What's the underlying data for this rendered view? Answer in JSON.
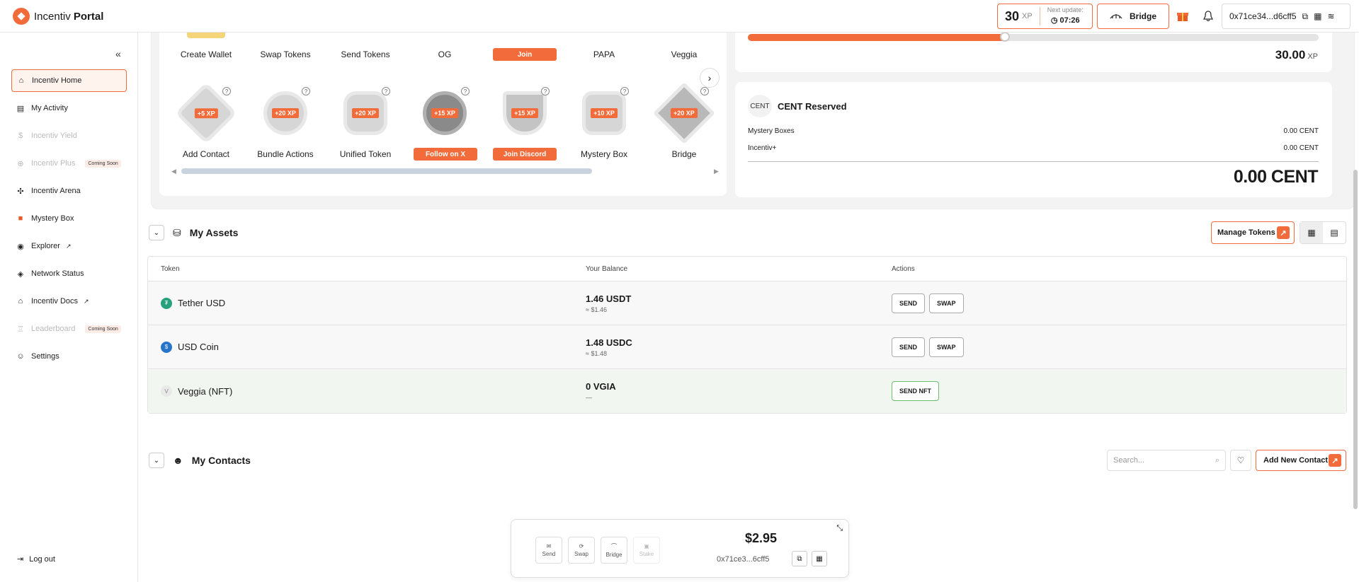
{
  "brand": {
    "name_light": "Incentiv",
    "name_bold": " Portal"
  },
  "topbar": {
    "xp_value": "30",
    "xp_unit": "XP",
    "next_update_label": "Next update:",
    "next_update_time": "07:26",
    "bridge_label": "Bridge",
    "wallet_address": "0x71ce34...d6cff5"
  },
  "sidebar": {
    "items": [
      {
        "label": "Incentiv Home"
      },
      {
        "label": "My Activity"
      },
      {
        "label": "Incentiv Yield"
      },
      {
        "label": "Incentiv Plus",
        "badge": "Coming Soon"
      },
      {
        "label": "Incentiv Arena"
      },
      {
        "label": "Mystery Box"
      },
      {
        "label": "Explorer"
      },
      {
        "label": "Network Status"
      },
      {
        "label": "Incentiv Docs"
      },
      {
        "label": "Leaderboard",
        "badge": "Coming Soon"
      },
      {
        "label": "Settings"
      }
    ],
    "logout": "Log out"
  },
  "quests": {
    "top_labels": [
      "Create Wallet",
      "Swap Tokens",
      "Send Tokens",
      "OG",
      "PAPA",
      "Veggia"
    ],
    "top_pill": "Join",
    "badges": [
      {
        "xp": "+5 XP",
        "label": "Add Contact"
      },
      {
        "xp": "+20 XP",
        "label": "Bundle Actions"
      },
      {
        "xp": "+20 XP",
        "label": "Unified Token"
      },
      {
        "xp": "+15 XP",
        "pill": "Follow on X"
      },
      {
        "xp": "+15 XP",
        "pill": "Join Discord"
      },
      {
        "xp": "+10 XP",
        "label": "Mystery Box"
      },
      {
        "xp": "+20 XP",
        "label": "Bridge"
      }
    ],
    "help_icon": "?"
  },
  "progress": {
    "fraction": 0.45,
    "total_value": "30.00",
    "total_unit": "XP"
  },
  "cent": {
    "img_alt": "CENT",
    "title": "CENT Reserved",
    "rows": [
      {
        "label": "Mystery Boxes",
        "value": "0.00 CENT"
      },
      {
        "label": "Incentiv+",
        "value": "0.00 CENT"
      }
    ],
    "total": "0.00 CENT"
  },
  "assets": {
    "title": "My Assets",
    "manage_label": "Manage Tokens",
    "columns": [
      "Token",
      "Your Balance",
      "Actions"
    ],
    "rows": [
      {
        "name": "Tether USD",
        "balance": "1.46 USDT",
        "usd": "≈ $1.46",
        "actions": [
          "SEND",
          "SWAP"
        ]
      },
      {
        "name": "USD Coin",
        "balance": "1.48 USDC",
        "usd": "≈ $1.48",
        "actions": [
          "SEND",
          "SWAP"
        ]
      },
      {
        "name": "Veggia (NFT)",
        "balance": "0 VGIA",
        "usd": "—",
        "actions": [
          "SEND NFT"
        ]
      }
    ]
  },
  "contacts": {
    "title": "My Contacts",
    "search_placeholder": "Search...",
    "add_label": "Add New Contact"
  },
  "dock": {
    "actions": [
      "Send",
      "Swap",
      "Bridge",
      "Stake"
    ],
    "balance": "$2.95",
    "address": "0x71ce3...6cff5"
  },
  "colors": {
    "accent": "#f26b3a"
  }
}
